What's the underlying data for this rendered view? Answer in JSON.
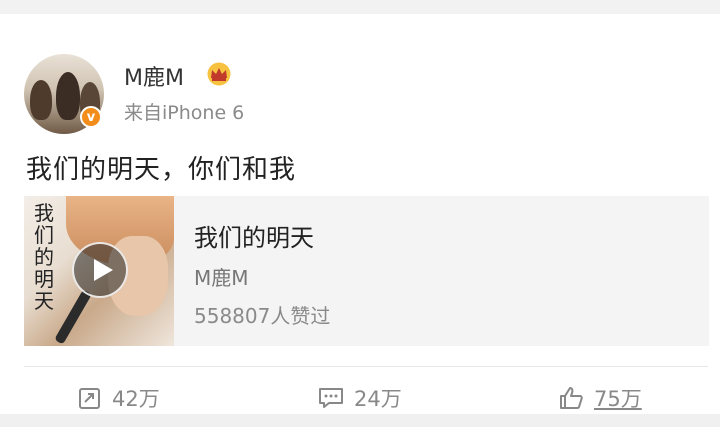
{
  "post": {
    "username": "M鹿M",
    "source": "来自iPhone 6",
    "text": "我们的明天，你们和我",
    "verified_mark": "v"
  },
  "music_card": {
    "title": "我们的明天",
    "artist": "M鹿M",
    "likes": "558807人赞过",
    "cover_vertical_title": "我们的明天"
  },
  "actions": {
    "repost_count": "42万",
    "comment_count": "24万",
    "like_count": "75万"
  },
  "icons": {
    "avatar": "avatar-image",
    "verified": "verified-badge-icon",
    "crown": "crown-icon",
    "play": "play-icon",
    "repost": "repost-icon",
    "comment": "comment-icon",
    "like": "thumbs-up-icon"
  },
  "colors": {
    "verified_badge": "#f28c1b",
    "crown": "#e8a92a",
    "secondary_text": "#888888"
  }
}
